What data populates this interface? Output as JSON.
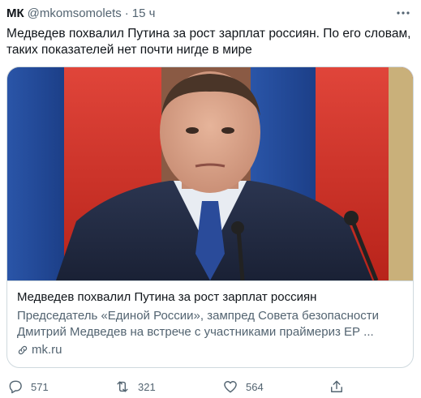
{
  "tweet": {
    "author_name": "МК",
    "handle": "@mkomsomolets",
    "separator": "·",
    "time": "15 ч",
    "text": "Медведев похвалил Путина за рост зарплат россиян. По его словам, таких показателей нет почти нигде в мире",
    "more_icon": "more-dots-icon"
  },
  "card": {
    "image_alt": "Фото",
    "title": "Медведев похвалил Путина за рост зарплат россиян",
    "description_line1": "Председатель «Единой России», зампред Совета безопасности",
    "description_line2": "Дмитрий Медведев на встрече с участниками праймериз ЕР ...",
    "domain": "mk.ru",
    "domain_icon": "link-icon"
  },
  "actions": {
    "reply_count": "571",
    "retweet_count": "321",
    "like_count": "564",
    "reply_icon": "reply-icon",
    "retweet_icon": "retweet-icon",
    "like_icon": "heart-icon",
    "share_icon": "share-icon"
  },
  "colors": {
    "text_primary": "#0f1419",
    "text_secondary": "#536471",
    "border": "#cfd9de",
    "flag_red": "#d52b1e",
    "flag_blue": "#1f4fa5"
  }
}
